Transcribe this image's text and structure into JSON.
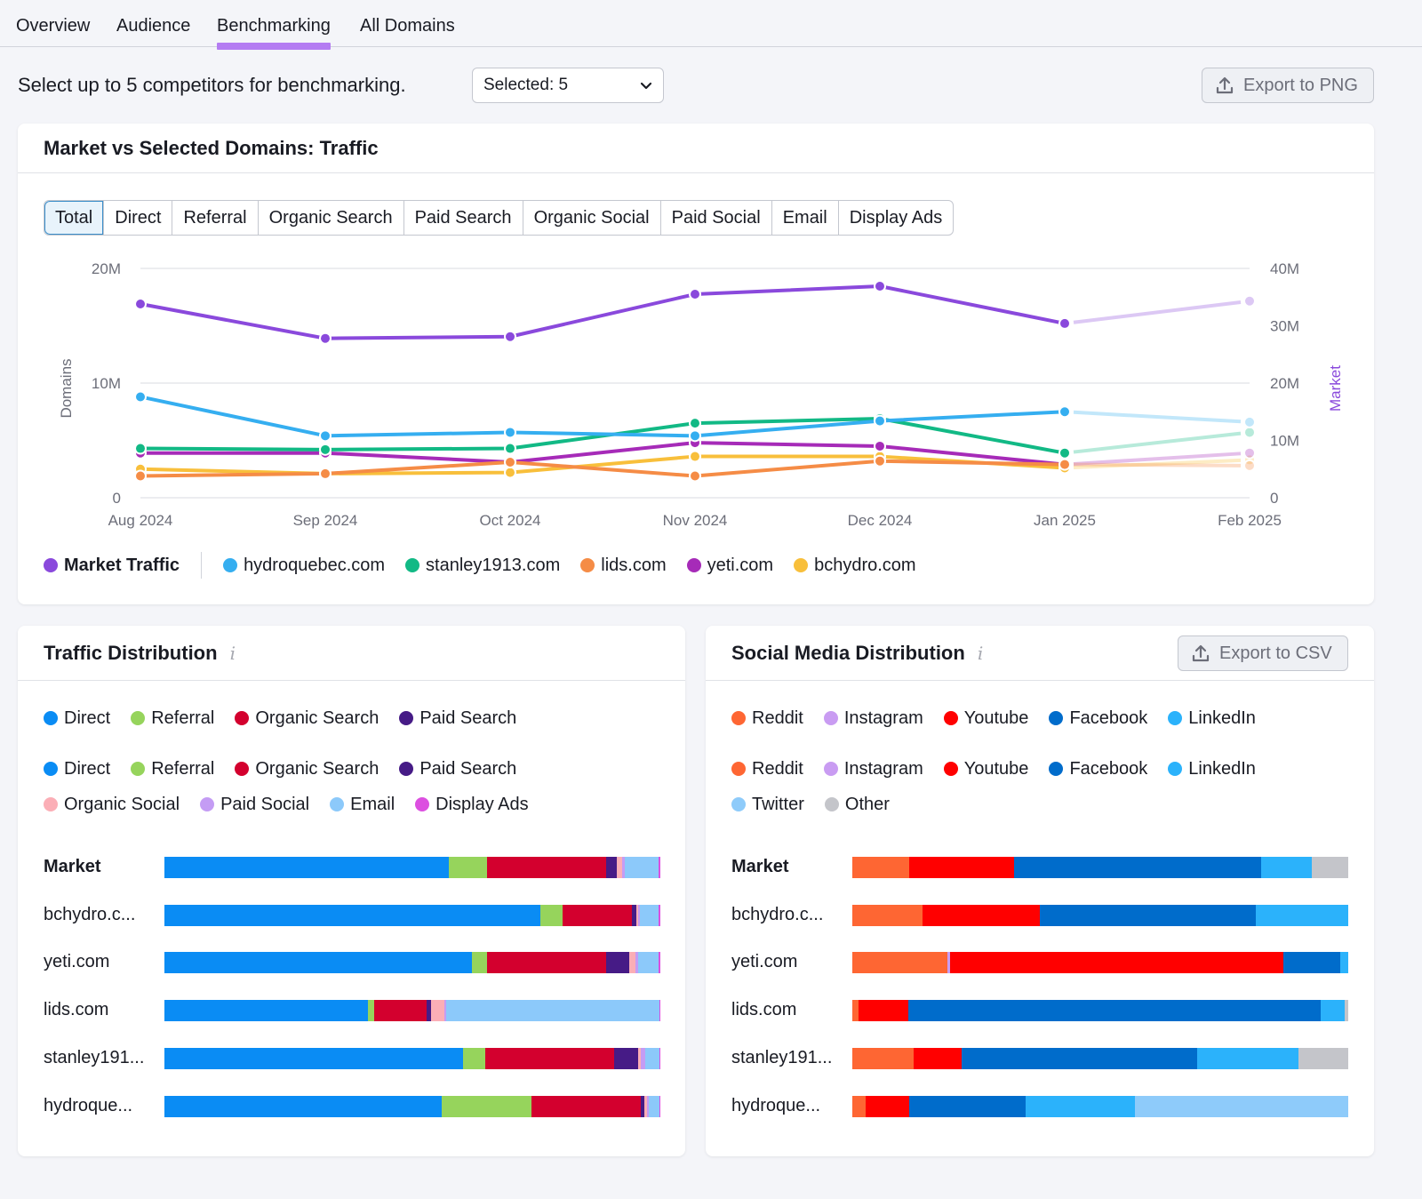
{
  "tabs": [
    {
      "label": "Overview",
      "active": false
    },
    {
      "label": "Audience",
      "active": false
    },
    {
      "label": "Benchmarking",
      "active": true
    },
    {
      "label": "All Domains",
      "active": false
    }
  ],
  "selector": {
    "label": "Select up to 5 competitors for benchmarking.",
    "value": "Selected: 5"
  },
  "export_png_label": "Export to PNG",
  "traffic_card": {
    "title": "Market vs Selected Domains: Traffic",
    "segments": [
      "Total",
      "Direct",
      "Referral",
      "Organic Search",
      "Paid Search",
      "Organic Social",
      "Paid Social",
      "Email",
      "Display Ads"
    ],
    "active_segment": "Total"
  },
  "chart_data": {
    "type": "line",
    "title": "Market vs Selected Domains: Traffic",
    "x": [
      "Aug 2024",
      "Sep 2024",
      "Oct 2024",
      "Nov 2024",
      "Dec 2024",
      "Jan 2025",
      "Feb 2025"
    ],
    "ylabel": "Domains",
    "ylabel_right": "Market",
    "ylim": [
      0,
      20000000
    ],
    "ylim_right": [
      0,
      40000000
    ],
    "yticks": [
      "0",
      "10M",
      "20M"
    ],
    "yticks_right": [
      "0",
      "10M",
      "20M",
      "30M",
      "40M"
    ],
    "grid": true,
    "legend_position": "bottom-left",
    "projected_last_point": true,
    "series": [
      {
        "name": "Market Traffic",
        "axis": "right",
        "color": "#8a49dc",
        "values": [
          33800000,
          27800000,
          28100000,
          35500000,
          36900000,
          30400000,
          34300000
        ]
      },
      {
        "name": "hydroquebec.com",
        "axis": "left",
        "color": "#35aef0",
        "values": [
          8800000,
          5400000,
          5700000,
          5400000,
          6700000,
          7500000,
          6600000
        ]
      },
      {
        "name": "stanley1913.com",
        "axis": "left",
        "color": "#12b985",
        "values": [
          4300000,
          4200000,
          4300000,
          6500000,
          6900000,
          3900000,
          5700000
        ]
      },
      {
        "name": "lids.com",
        "axis": "left",
        "color": "#f58c46",
        "values": [
          1900000,
          2100000,
          3100000,
          1900000,
          3200000,
          2900000,
          2800000
        ]
      },
      {
        "name": "yeti.com",
        "axis": "left",
        "color": "#a62bb8",
        "values": [
          3900000,
          3900000,
          3100000,
          4800000,
          4500000,
          2900000,
          3900000
        ]
      },
      {
        "name": "bchydro.com",
        "axis": "left",
        "color": "#f8bf3b",
        "values": [
          2500000,
          2100000,
          2200000,
          3600000,
          3600000,
          2600000,
          3300000
        ]
      }
    ]
  },
  "traffic_distribution": {
    "title": "Traffic Distribution",
    "legend_top": [
      {
        "label": "Direct",
        "color": "#0a8cf4"
      },
      {
        "label": "Referral",
        "color": "#96d45c"
      },
      {
        "label": "Organic Search",
        "color": "#d3002e"
      },
      {
        "label": "Paid Search",
        "color": "#461b86"
      }
    ],
    "legend": [
      {
        "label": "Direct",
        "color": "#0a8cf4"
      },
      {
        "label": "Referral",
        "color": "#96d45c"
      },
      {
        "label": "Organic Search",
        "color": "#d3002e"
      },
      {
        "label": "Paid Search",
        "color": "#461b86"
      },
      {
        "label": "Organic Social",
        "color": "#fbaeb6"
      },
      {
        "label": "Paid Social",
        "color": "#c49cf4"
      },
      {
        "label": "Email",
        "color": "#8cc9fa"
      },
      {
        "label": "Display Ads",
        "color": "#dc4fe0"
      }
    ],
    "rows": [
      {
        "label": "Market",
        "bold": true,
        "shares": [
          57.3,
          7.7,
          24.0,
          2.3,
          1.0,
          0.5,
          6.8,
          0.4
        ]
      },
      {
        "label": "bchydro.c...",
        "bold": false,
        "shares": [
          75.8,
          4.5,
          14.0,
          0.9,
          0.4,
          0.2,
          3.8,
          0.4
        ]
      },
      {
        "label": "yeti.com",
        "bold": false,
        "shares": [
          62.0,
          3.0,
          24.0,
          4.8,
          1.2,
          0.6,
          4.0,
          0.4
        ]
      },
      {
        "label": "lids.com",
        "bold": false,
        "shares": [
          41.0,
          1.3,
          10.5,
          1.0,
          2.6,
          0.4,
          43.0,
          0.2
        ]
      },
      {
        "label": "stanley191...",
        "bold": false,
        "shares": [
          60.3,
          4.4,
          26.0,
          4.8,
          0.6,
          0.9,
          2.8,
          0.2
        ]
      },
      {
        "label": "hydroque...",
        "bold": false,
        "shares": [
          56.0,
          18.0,
          22.0,
          0.8,
          0.6,
          0.2,
          2.2,
          0.2
        ]
      }
    ]
  },
  "social_distribution": {
    "title": "Social Media Distribution",
    "export_label": "Export to CSV",
    "legend_top": [
      {
        "label": "Reddit",
        "color": "#fe6633"
      },
      {
        "label": "Instagram",
        "color": "#c99cf2"
      },
      {
        "label": "Youtube",
        "color": "#ff0000"
      },
      {
        "label": "Facebook",
        "color": "#006ccb"
      },
      {
        "label": "LinkedIn",
        "color": "#2bb2fb"
      }
    ],
    "legend": [
      {
        "label": "Reddit",
        "color": "#fe6633"
      },
      {
        "label": "Instagram",
        "color": "#c99cf2"
      },
      {
        "label": "Youtube",
        "color": "#ff0000"
      },
      {
        "label": "Facebook",
        "color": "#006ccb"
      },
      {
        "label": "LinkedIn",
        "color": "#2bb2fb"
      },
      {
        "label": "Twitter",
        "color": "#8ecbfa"
      },
      {
        "label": "Other",
        "color": "#c4c5ca"
      }
    ],
    "rows": [
      {
        "label": "Market",
        "bold": true,
        "shares": [
          11.4,
          0,
          21.3,
          49.8,
          10.2,
          0,
          7.3
        ]
      },
      {
        "label": "bchydro.c...",
        "bold": false,
        "shares": [
          14.2,
          0,
          23.6,
          43.6,
          18.6,
          0,
          0
        ]
      },
      {
        "label": "yeti.com",
        "bold": false,
        "shares": [
          19.1,
          0.6,
          67.2,
          11.5,
          1.6,
          0,
          0
        ]
      },
      {
        "label": "lids.com",
        "bold": false,
        "shares": [
          1.3,
          0,
          10.0,
          83.2,
          4.7,
          0,
          0.8
        ]
      },
      {
        "label": "stanley191...",
        "bold": false,
        "shares": [
          12.3,
          0,
          9.7,
          47.5,
          20.4,
          0,
          10.1
        ]
      },
      {
        "label": "hydroque...",
        "bold": false,
        "shares": [
          2.7,
          0,
          8.8,
          23.5,
          22.0,
          43.0,
          0
        ]
      }
    ]
  }
}
